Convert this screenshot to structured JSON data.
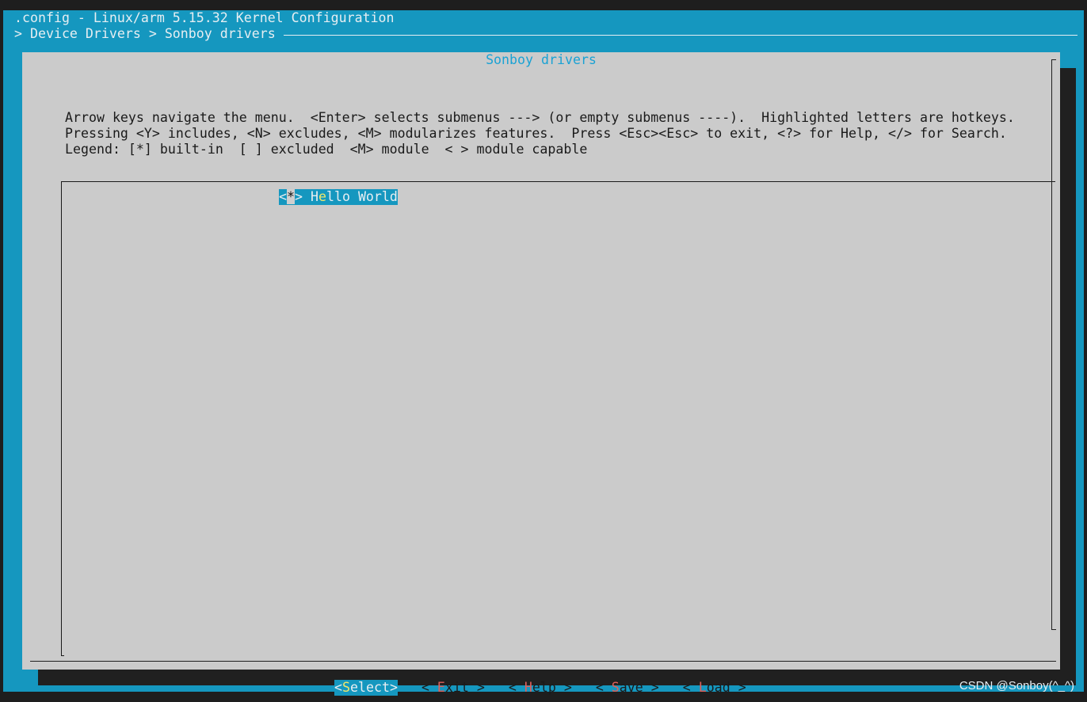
{
  "terminal": {
    "title": ".config - Linux/arm 5.15.32 Kernel Configuration",
    "breadcrumb": "> Device Drivers > Sonboy drivers"
  },
  "dialog": {
    "title": "Sonboy drivers",
    "help_lines": [
      "Arrow keys navigate the menu.  <Enter> selects submenus ---> (or empty submenus ----).  Highlighted letters are hotkeys.",
      "Pressing <Y> includes, <N> excludes, <M> modularizes features.  Press <Esc><Esc> to exit, <?> for Help, </> for Search.",
      "Legend: [*] built-in  [ ] excluded  <M> module  < > module capable"
    ],
    "menu_items": [
      {
        "state_open": "<",
        "state": "*",
        "state_close": ">",
        "label_pre": " H",
        "label_hot": "e",
        "label_post": "llo World",
        "selected": true
      }
    ],
    "buttons": [
      {
        "open": "<",
        "hot": "S",
        "rest": "elect",
        "close": ">",
        "active": true
      },
      {
        "open": "< ",
        "hot": "E",
        "rest": "xit",
        "close": " >",
        "active": false
      },
      {
        "open": "< ",
        "hot": "H",
        "rest": "elp",
        "close": " >",
        "active": false
      },
      {
        "open": "< ",
        "hot": "S",
        "rest": "ave",
        "close": " >",
        "active": false
      },
      {
        "open": "< ",
        "hot": "L",
        "rest": "oad",
        "close": " >",
        "active": false
      }
    ]
  },
  "watermark": "CSDN @Sonboy(^_^)",
  "colors": {
    "terminal_bg": "#1597bf",
    "dialog_bg": "#cbcbcb",
    "title_fg": "#1aa2d4",
    "hotkey_fg": "#e0605a",
    "active_hotkey_fg": "#f1e86a"
  }
}
